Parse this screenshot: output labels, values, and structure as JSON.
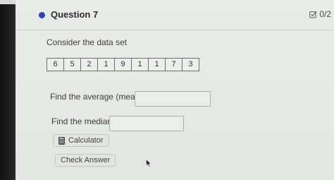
{
  "question": {
    "title": "Question 7",
    "score": "0/2",
    "prompt": "Consider the data set",
    "data_set": [
      "6",
      "5",
      "2",
      "1",
      "9",
      "1",
      "1",
      "7",
      "3"
    ]
  },
  "form": {
    "mean_label": "Find the average (mean):",
    "mean_value": "",
    "median_label": "Find the median:",
    "median_value": ""
  },
  "buttons": {
    "calculator_label": "Calculator",
    "check_label": "Check Answer"
  },
  "colors": {
    "accent_dot": "#2a44b7"
  }
}
